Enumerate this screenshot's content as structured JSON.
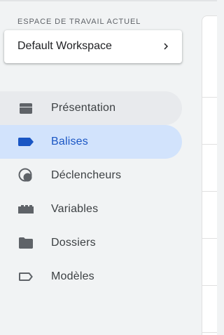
{
  "sidebar": {
    "workspace_section_label": "ESPACE DE TRAVAIL ACTUEL",
    "workspace_name": "Default Workspace",
    "items": [
      {
        "label": "Présentation",
        "icon": "overview-folder-icon",
        "state": "hover"
      },
      {
        "label": "Balises",
        "icon": "tag-icon",
        "state": "active"
      },
      {
        "label": "Déclencheurs",
        "icon": "trigger-icon",
        "state": "normal"
      },
      {
        "label": "Variables",
        "icon": "variables-icon",
        "state": "normal"
      },
      {
        "label": "Dossiers",
        "icon": "folder-icon",
        "state": "normal"
      },
      {
        "label": "Modèles",
        "icon": "template-tag-outline-icon",
        "state": "normal"
      }
    ]
  },
  "colors": {
    "sidebar_background": "#f1f3f4",
    "active_background": "#d2e3fc",
    "active_accent": "#1a56c4",
    "hover_background": "#e8eaed",
    "icon_gray": "#5f6368",
    "text_dark": "#3c4043"
  }
}
